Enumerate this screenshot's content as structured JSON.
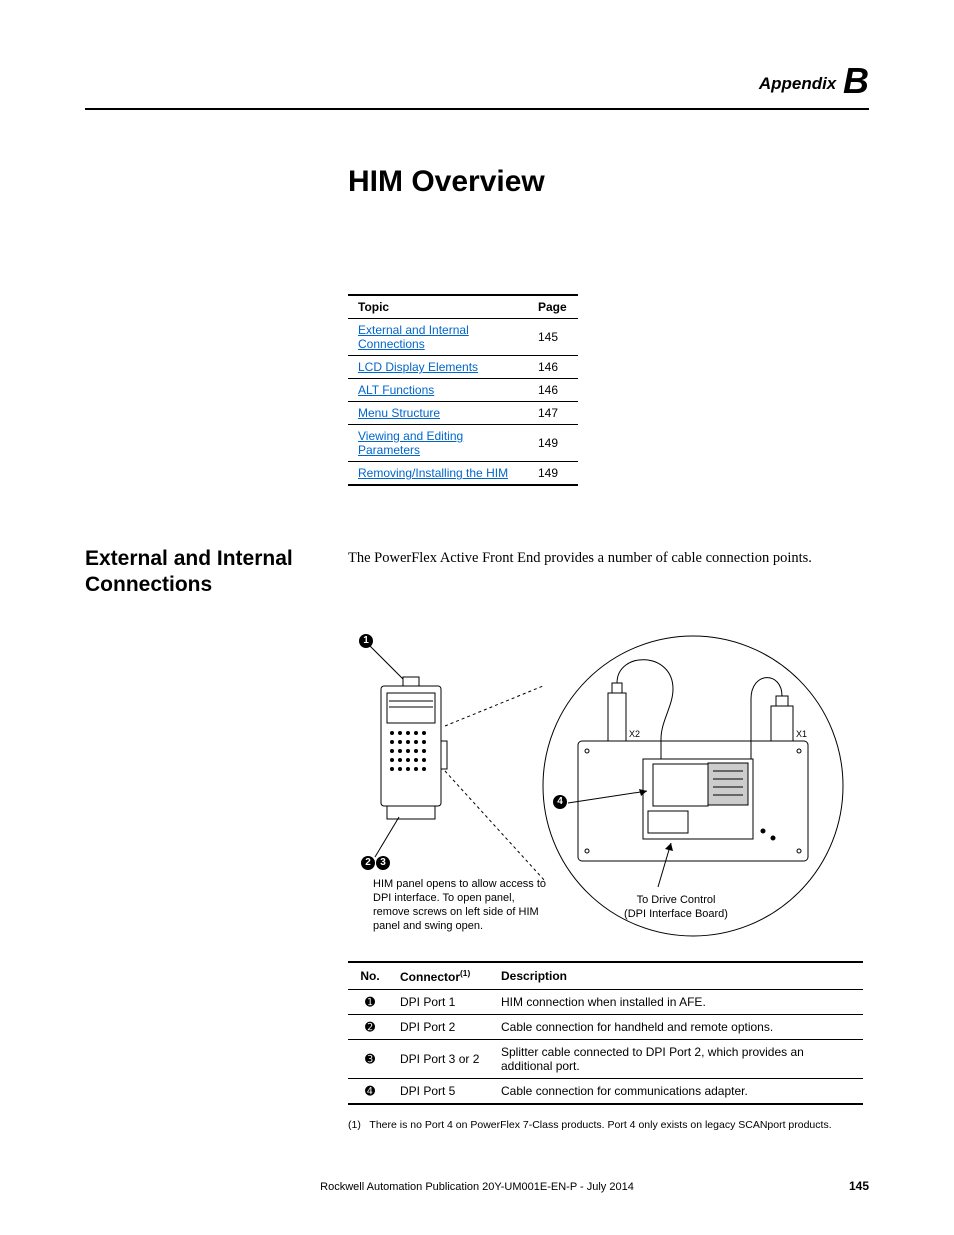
{
  "appendix": {
    "label": "Appendix",
    "letter": "B"
  },
  "title": "HIM Overview",
  "toc": {
    "headers": {
      "topic": "Topic",
      "page": "Page"
    },
    "rows": [
      {
        "topic": "External and Internal Connections",
        "page": "145"
      },
      {
        "topic": "LCD Display Elements",
        "page": "146"
      },
      {
        "topic": "ALT Functions",
        "page": "146"
      },
      {
        "topic": "Menu Structure",
        "page": "147"
      },
      {
        "topic": "Viewing and Editing Parameters",
        "page": "149"
      },
      {
        "topic": "Removing/Installing the HIM",
        "page": "149"
      }
    ]
  },
  "section": {
    "heading": "External and Internal Connections",
    "body": "The PowerFlex Active Front End provides a number of cable connection points."
  },
  "diagram": {
    "callouts": {
      "c1": "1",
      "c2": "2",
      "c3": "3",
      "c4": "4"
    },
    "note": "HIM panel opens to allow access to DPI interface. To open panel, remove screws on left side of HIM panel and swing open.",
    "detail_label1": "To Drive Control",
    "detail_label2": "(DPI Interface Board)",
    "x1": "X1",
    "x2": "X2"
  },
  "conn_table": {
    "headers": {
      "no": "No.",
      "connector": "Connector",
      "conn_sup": "(1)",
      "description": "Description"
    },
    "rows": [
      {
        "n": "➊",
        "conn": "DPI Port 1",
        "desc": "HIM connection when installed in AFE."
      },
      {
        "n": "➋",
        "conn": "DPI Port 2",
        "desc": "Cable connection for handheld and remote options."
      },
      {
        "n": "➌",
        "conn": "DPI Port 3 or 2",
        "desc": "Splitter cable connected to DPI Port 2, which provides an additional port."
      },
      {
        "n": "➍",
        "conn": "DPI Port 5",
        "desc": "Cable connection for communications adapter."
      }
    ]
  },
  "footnote": {
    "num": "(1)",
    "text": "There is no Port 4 on PowerFlex 7-Class products. Port 4 only exists on legacy SCANport products."
  },
  "footer": "Rockwell Automation Publication 20Y-UM001E-EN-P - July 2014",
  "page_number": "145"
}
